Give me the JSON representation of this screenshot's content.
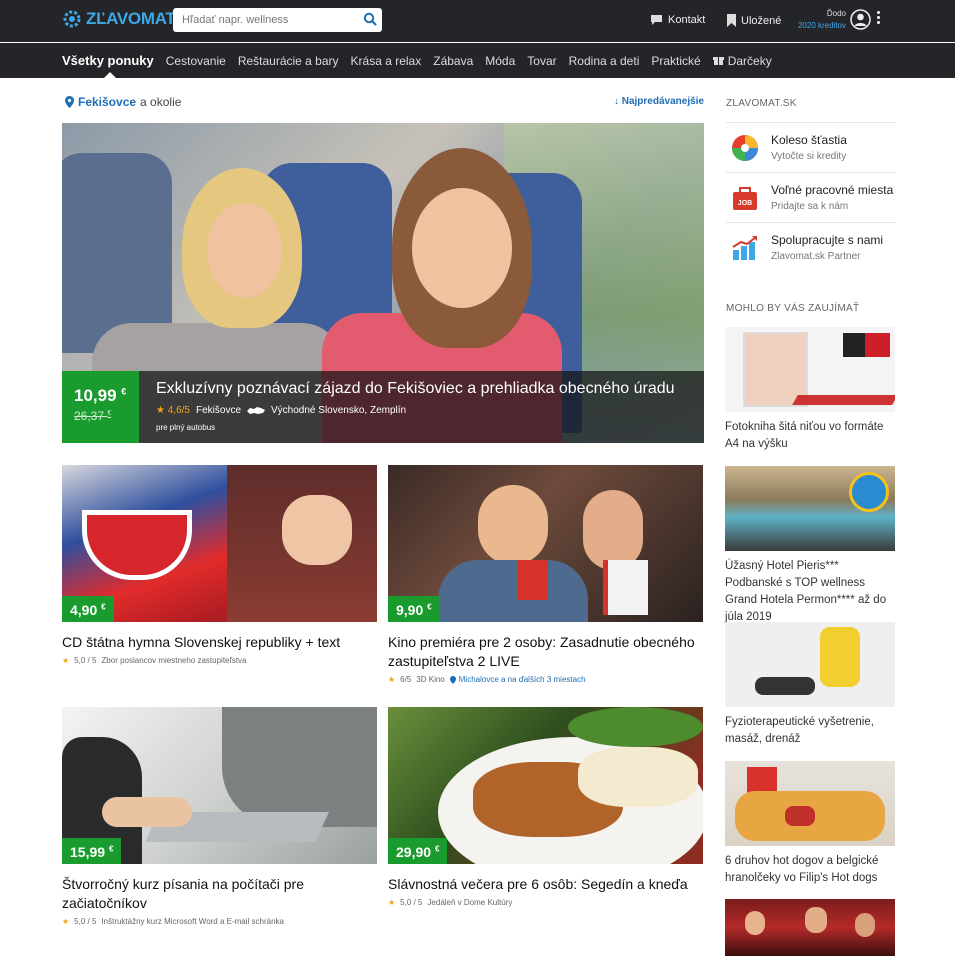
{
  "header": {
    "logo": "ZĽAVOMAT",
    "search_placeholder": "Hľadať napr. wellness",
    "contact": "Kontakt",
    "saved": "Uložené",
    "user_name": "Ďodo",
    "user_credits": "2020 kreditov"
  },
  "categories": [
    {
      "label": "Všetky ponuky",
      "active": true
    },
    {
      "label": "Cestovanie"
    },
    {
      "label": "Reštaurácie a bary"
    },
    {
      "label": "Krása a relax"
    },
    {
      "label": "Zábava"
    },
    {
      "label": "Móda"
    },
    {
      "label": "Tovar"
    },
    {
      "label": "Rodina a deti"
    },
    {
      "label": "Praktické"
    },
    {
      "label": "Darčeky"
    }
  ],
  "location": {
    "city": "Fekišovce",
    "suffix": "a okolie",
    "sort": "↓ Najpredávanejšie"
  },
  "hero": {
    "price": "10,99",
    "currency": "€",
    "old_price": "26,37",
    "title": "Exkluzívny poznávací zájazd do Fekišoviec a prehliadka obecného úradu",
    "rating": "4,6/5",
    "place": "Fekišovce",
    "region": "Východné Slovensko, Zemplín",
    "note": "pre plný autobus"
  },
  "cards": [
    {
      "price": "4,90",
      "title": "CD štátna hymna Slovenskej republiky + text",
      "rating": "5,0 / 5",
      "desc": "Zbor poslancov miestneho zastupiteľstva",
      "location": ""
    },
    {
      "price": "9,90",
      "title": "Kino premiéra pre 2 osoby: Zasadnutie obecného zastupiteľstva 2 LIVE",
      "rating": "6/5",
      "desc": "3D Kino",
      "location": "Michalovce a na ďalších 3 miestach"
    },
    {
      "price": "15,99",
      "title": "Štvorročný kurz písania na počítači pre začiatočníkov",
      "rating": "5,0 / 5",
      "desc": "Inštruktážny kurz Microsoft Word a E-mail schránka",
      "location": ""
    },
    {
      "price": "29,90",
      "title": "Slávnostná večera pre 6 osôb: Segedín a kneďa",
      "rating": "5,0 / 5",
      "desc": "Jedáleň v Dome Kultúry",
      "location": ""
    }
  ],
  "sidebar": {
    "heading": "ZLAVOMAT.SK",
    "items": [
      {
        "title": "Koleso šťastia",
        "sub": "Vytočte si kredity",
        "icon": "wheel-icon"
      },
      {
        "title": "Voľné pracovné miesta",
        "sub": "Pridajte sa k nám",
        "icon": "job-icon"
      },
      {
        "title": "Spolupracujte s nami",
        "sub": "Zlavomat.sk Partner",
        "icon": "chart-icon"
      }
    ],
    "heading2": "MOHLO BY VÁS ZAUJÍMAŤ",
    "ads": [
      {
        "text": "Fotokniha šitá niťou vo formáte A4 na výšku"
      },
      {
        "text": "Úžasný Hotel Pieris*** Podbanské s TOP wellness Grand Hotela Permon**** až do júla 2019"
      },
      {
        "text": "Fyzioterapeutické vyšetrenie, masáž, drenáž"
      },
      {
        "text": "6 druhov hot dogov a belgické hranolčeky vo Filip's Hot dogs"
      },
      {
        "text": ""
      }
    ]
  }
}
